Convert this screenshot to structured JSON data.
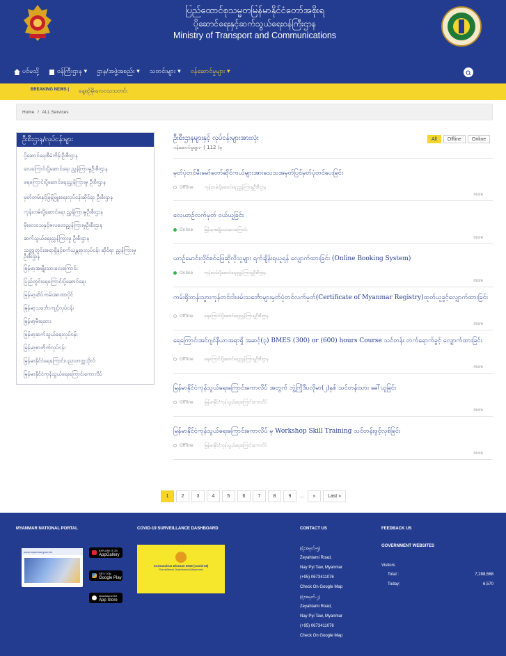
{
  "header": {
    "title_my_line1": "ပြည်ထောင်စုသမ္မတမြန်မာနိုင်ငံတော်အစိုးရ",
    "title_my_line2": "ပို့ဆောင်ရေးနှင့်ဆက်သွယ်ရေးဝန်ကြီးဌာန",
    "title_en": "Ministry of Transport and Communications"
  },
  "nav": [
    {
      "label": "ပင်မသို့",
      "icon": "home-icon"
    },
    {
      "label": "ဝန်ကြီးဌာန",
      "icon": "building-icon"
    },
    {
      "label": "ဌာန/အဖွဲ့အစည်း"
    },
    {
      "label": "သတင်းများ"
    },
    {
      "label": "ဝန်ဆောင်မှုများ"
    }
  ],
  "breaking": {
    "label": "BREAKING NEWS |",
    "text": "နေ့စဉ်မိုးလေဝသသတင်း"
  },
  "breadcrumb": {
    "home": "Home",
    "sep": "/",
    "current": "ALL Services"
  },
  "sidebar": {
    "title": "ဦးစီးဌာန/လုပ်ငန်းများ",
    "items": [
      "ပို့ဆောင်ရေးစီမံကိန်းဦးစီးဌာန",
      "လေကြောင်းပို့ဆောင်ရေး ညွှန်ကြားမှုဦးစီးဌာန",
      "ရေကြောင်းပို့ဆောင်ရေးညွှန်ကြားမှု ဦးစီးဌာန",
      "မှတ်တမ်းနှင့်ဖြန့်ဖြူးရေးလုပ်ငန်းဆိုင်ရာ ဦးစီးဌာန",
      "ကုန်းလမ်းပို့ဆောင်ရေး ညွှန်ကြားမှုဦးစီးဌာန",
      "မိုးလေဝသနှင့်ဇလဗေဒညွှန်ကြားမှုဦးစီးဌာန",
      "ဆက်သွယ်ရေးညွှန်ကြားမှု ဦးစီးဌာန",
      "သတ္တုတွင်းအရာရှိနှင့်စက်ယန္တရားလုပ်ငန်း ဆိုင်ရာ ညွှန်ကြားမှုဦးစီးဌာန",
      "မြန်မာ့အမျိုးသားလေကြောင်း",
      "ပြည်တွင်းရေကြောင်းပို့ဆောင်ရေး",
      "မြန်မာ့ဆိပ်ကမ်းအာဏာပိုင်",
      "မြန်မာ့သင်္ဘောကျင့်လုပ်ငန်း",
      "မြန်မာ့မီးရထား",
      "မြန်မာ့ဆက်သွယ်ရေးလုပ်ငန်း",
      "မြန်မာ့စာတိုက်လုပ်ငန်း",
      "မြန်မာနိုင်ငံရေကြောင်းပညာတက္ကသိုလ်",
      "မြန်မာနိုင်ငံကုန်သွယ်ရေးကြောင်းကောလိပ်"
    ]
  },
  "main": {
    "title": "ဦးစီးဌာနများနှင့် လုပ်ငန်းများအားလုံး",
    "subtitle": "ဝန်ဆောင်မှုများ- ( 112 )ခု",
    "filters": [
      "All",
      "Offline",
      "Online"
    ],
    "more_label": "more",
    "services": [
      {
        "title": "မှတ်ပုံတင်မီးမော်တော်ဆိုင်ကယ်များအားသေသအမှတ်ပြင်မှတ်ပုံတင်ပေးခြင်း",
        "status": "Offline",
        "dept": "ကုန်းလမ်းပို့ဆောင်ရေးညွှန်ကြားမှုဦးစီးဌာန"
      },
      {
        "title": "လေယာဉ်လက်မှတ် ဝယ်ယူခြင်း",
        "status": "Online",
        "dept": "မြန်မာ့အမျိုးသားလေကြောင်း"
      },
      {
        "title": "ယာဉ်မောင်းလိုင်စင်ဖြေဆိုလိုသူများ ရက်ချိန်းရယူရန် လျှောက်ထားခြင်း (Online Booking System)",
        "status": "Online",
        "dept": "ကုန်းလမ်းပို့ဆောင်ရေးညွှန်ကြားမှုဦးစီးဌာန"
      },
      {
        "title": "ကမ်းရိုးတန်းသွားကုန်တင်ငါးဖမ်းသင်္ဘောများမှတ်ပုံတင်လက်မှတ်(Certificate of Myanmar Registry)ထုတ်ယူခွင့်လျှောက်ထားခြင်း",
        "status": "Offline",
        "dept": "ရေကြောင်းပို့ဆောင်ရေးညွှန်ကြားမှုဦးစီးဌာန"
      },
      {
        "title": "ရေကြောင်းအင်ဂျင်နီယာအရာရှိ အဆင့်(၃) BMES (300) or (600) hours Course သင်တန်း တက်ရောက်ခွင့် လျှောက်ထားခြင်း",
        "status": "Offline",
        "dept": "ရေကြောင်းပို့ဆောင်ရေးညွှန်ကြားမှုဦးစီးဌာန"
      },
      {
        "title": "မြန်မာနိုင်ငံကုန်သွယ်ရေးကြောင်းကောလိပ် အတွက် ဘွဲ့ကြိုဒီပလိုမာ(၂)နှစ် သင်တန်းသား ခေါ်ယူခြင်း",
        "status": "Offline",
        "dept": "မြန်မာနိုင်ငံကုန်သွယ်ရေးကြောင်းကောလိပ်"
      },
      {
        "title": "မြန်မာနိုင်ငံကုန်သွယ်ရေးကြောင်းကောလိပ် မှ Workshop Skill Training သင်တန်းဖွင့်လှစ်ခြင်း",
        "status": "Offline",
        "dept": "မြန်မာနိုင်ငံကုန်သွယ်ရေးကြောင်းကောလိပ်"
      }
    ]
  },
  "pagination": {
    "pages": [
      "1",
      "2",
      "3",
      "4",
      "5",
      "6",
      "7",
      "8",
      "9"
    ],
    "ellipsis": "...",
    "next": "»",
    "last": "Last »"
  },
  "footer": {
    "portal_heading": "MYANMAR NATIONAL PORTAL",
    "portal_card_text": "www.myanmar.gov.mm",
    "covid_heading": "COVID-19 SURVEILLANCE DASHBOARD",
    "covid_title": "Coronavirus Disease 2019 (covid-19)",
    "covid_sub": "Surveillance Dashboard (Myanmar)",
    "stores": [
      {
        "small": "EXPLORE IT ON",
        "name": "AppGallery"
      },
      {
        "small": "GET IT ON",
        "name": "Google Play"
      },
      {
        "small": "Download on the",
        "name": "App Store"
      }
    ],
    "contact_heading": "CONTACT US",
    "contact_lines": [
      "(ရုံးအမှတ်-၅)",
      "Zeyahtami Road,",
      "Nay Pyi Taw, Myanmar",
      "(+95) 0673411076",
      "Check On Google Map",
      "(ရုံးအမှတ်-၂)",
      "Zeyahtami Road,",
      "Nay Pyi Taw, Myanmar",
      "(+95) 0673411076",
      "Check On Google Map"
    ],
    "feedback_heading": "FEEDBACK US",
    "gov_heading": "GOVERNMENT WEBSITES",
    "visitors_label": "Visitors",
    "total_label": "Total :",
    "total_value": "7,288,568",
    "today_label": "Today:",
    "today_value": "6,570"
  },
  "colors": {
    "primary": "#233c8f",
    "accent": "#f6d52b",
    "online": "#2fb84d"
  }
}
